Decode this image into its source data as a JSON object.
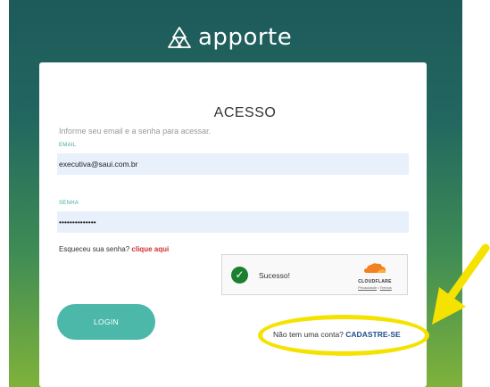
{
  "brand": {
    "name": "apporte"
  },
  "login_form": {
    "title": "ACESSO",
    "subtitle": "Informe seu email e a senha para acessar.",
    "email_label": "EMAIL",
    "email_value": "executiva@saui.com.br",
    "password_label": "SENHA",
    "password_value": "••••••••••••••",
    "forgot_text": "Esqueceu sua senha?",
    "forgot_link": "clique aqui",
    "login_button": "LOGIN",
    "signup_text": "Não tem uma conta?",
    "signup_link": "CADASTRE-SE"
  },
  "captcha": {
    "status": "Sucesso!",
    "provider": "CLOUDFLARE",
    "privacy": "Privacidade",
    "terms": "Termos",
    "separator": "•"
  },
  "colors": {
    "accent": "#4bb8aa",
    "link_red": "#d32f2f",
    "highlight": "#f5e200",
    "cloudflare_orange": "#f48120"
  }
}
